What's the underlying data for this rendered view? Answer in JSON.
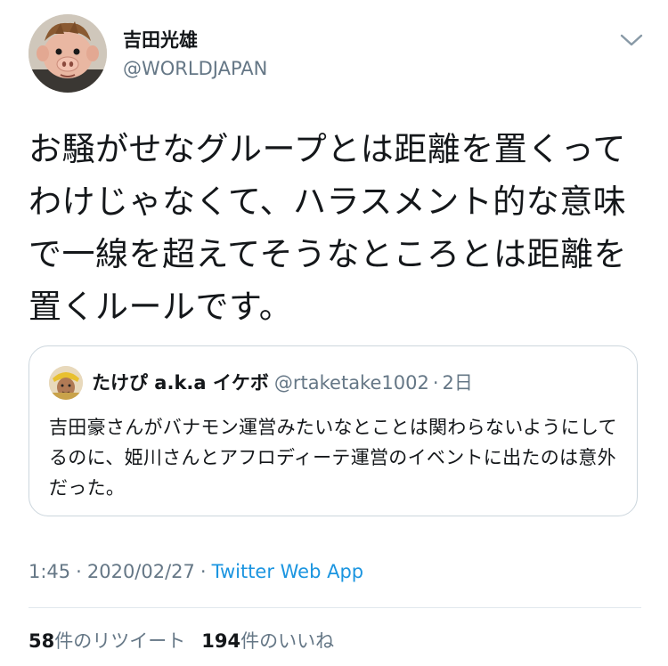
{
  "author": {
    "display_name": "吉田光雄",
    "handle": "@WORLDJAPAN",
    "avatar_icon": "pig-character-avatar-icon"
  },
  "menu": {
    "icon": "chevron-down-icon"
  },
  "tweet": {
    "text": "お騒がせなグループとは距離を置くってわけじゃなくて、ハラスメント的な意味で一線を超えてそうなところとは距離を置くルールです。"
  },
  "quote": {
    "name": "たけぴ a.k.a イケボ",
    "handle": "@rtaketake1002",
    "separator": "·",
    "date": "2日",
    "text": "吉田豪さんがバナモン運営みたいなとことは関わらないようにしてるのに、姫川さんとアフロディーテ運営のイベントに出たのは意外だった。",
    "avatar_icon": "user-avatar-icon"
  },
  "meta": {
    "time": "1:45",
    "separator": "·",
    "date": "2020/02/27",
    "source": "Twitter Web App"
  },
  "stats": {
    "retweet_count": "58",
    "retweet_label": "件のリツイート",
    "like_count": "194",
    "like_label": "件のいいね"
  },
  "colors": {
    "text_primary": "#14171a",
    "text_secondary": "#657786",
    "link": "#1b95e0",
    "border": "#ccd6dd",
    "divider": "#e1e8ed"
  }
}
